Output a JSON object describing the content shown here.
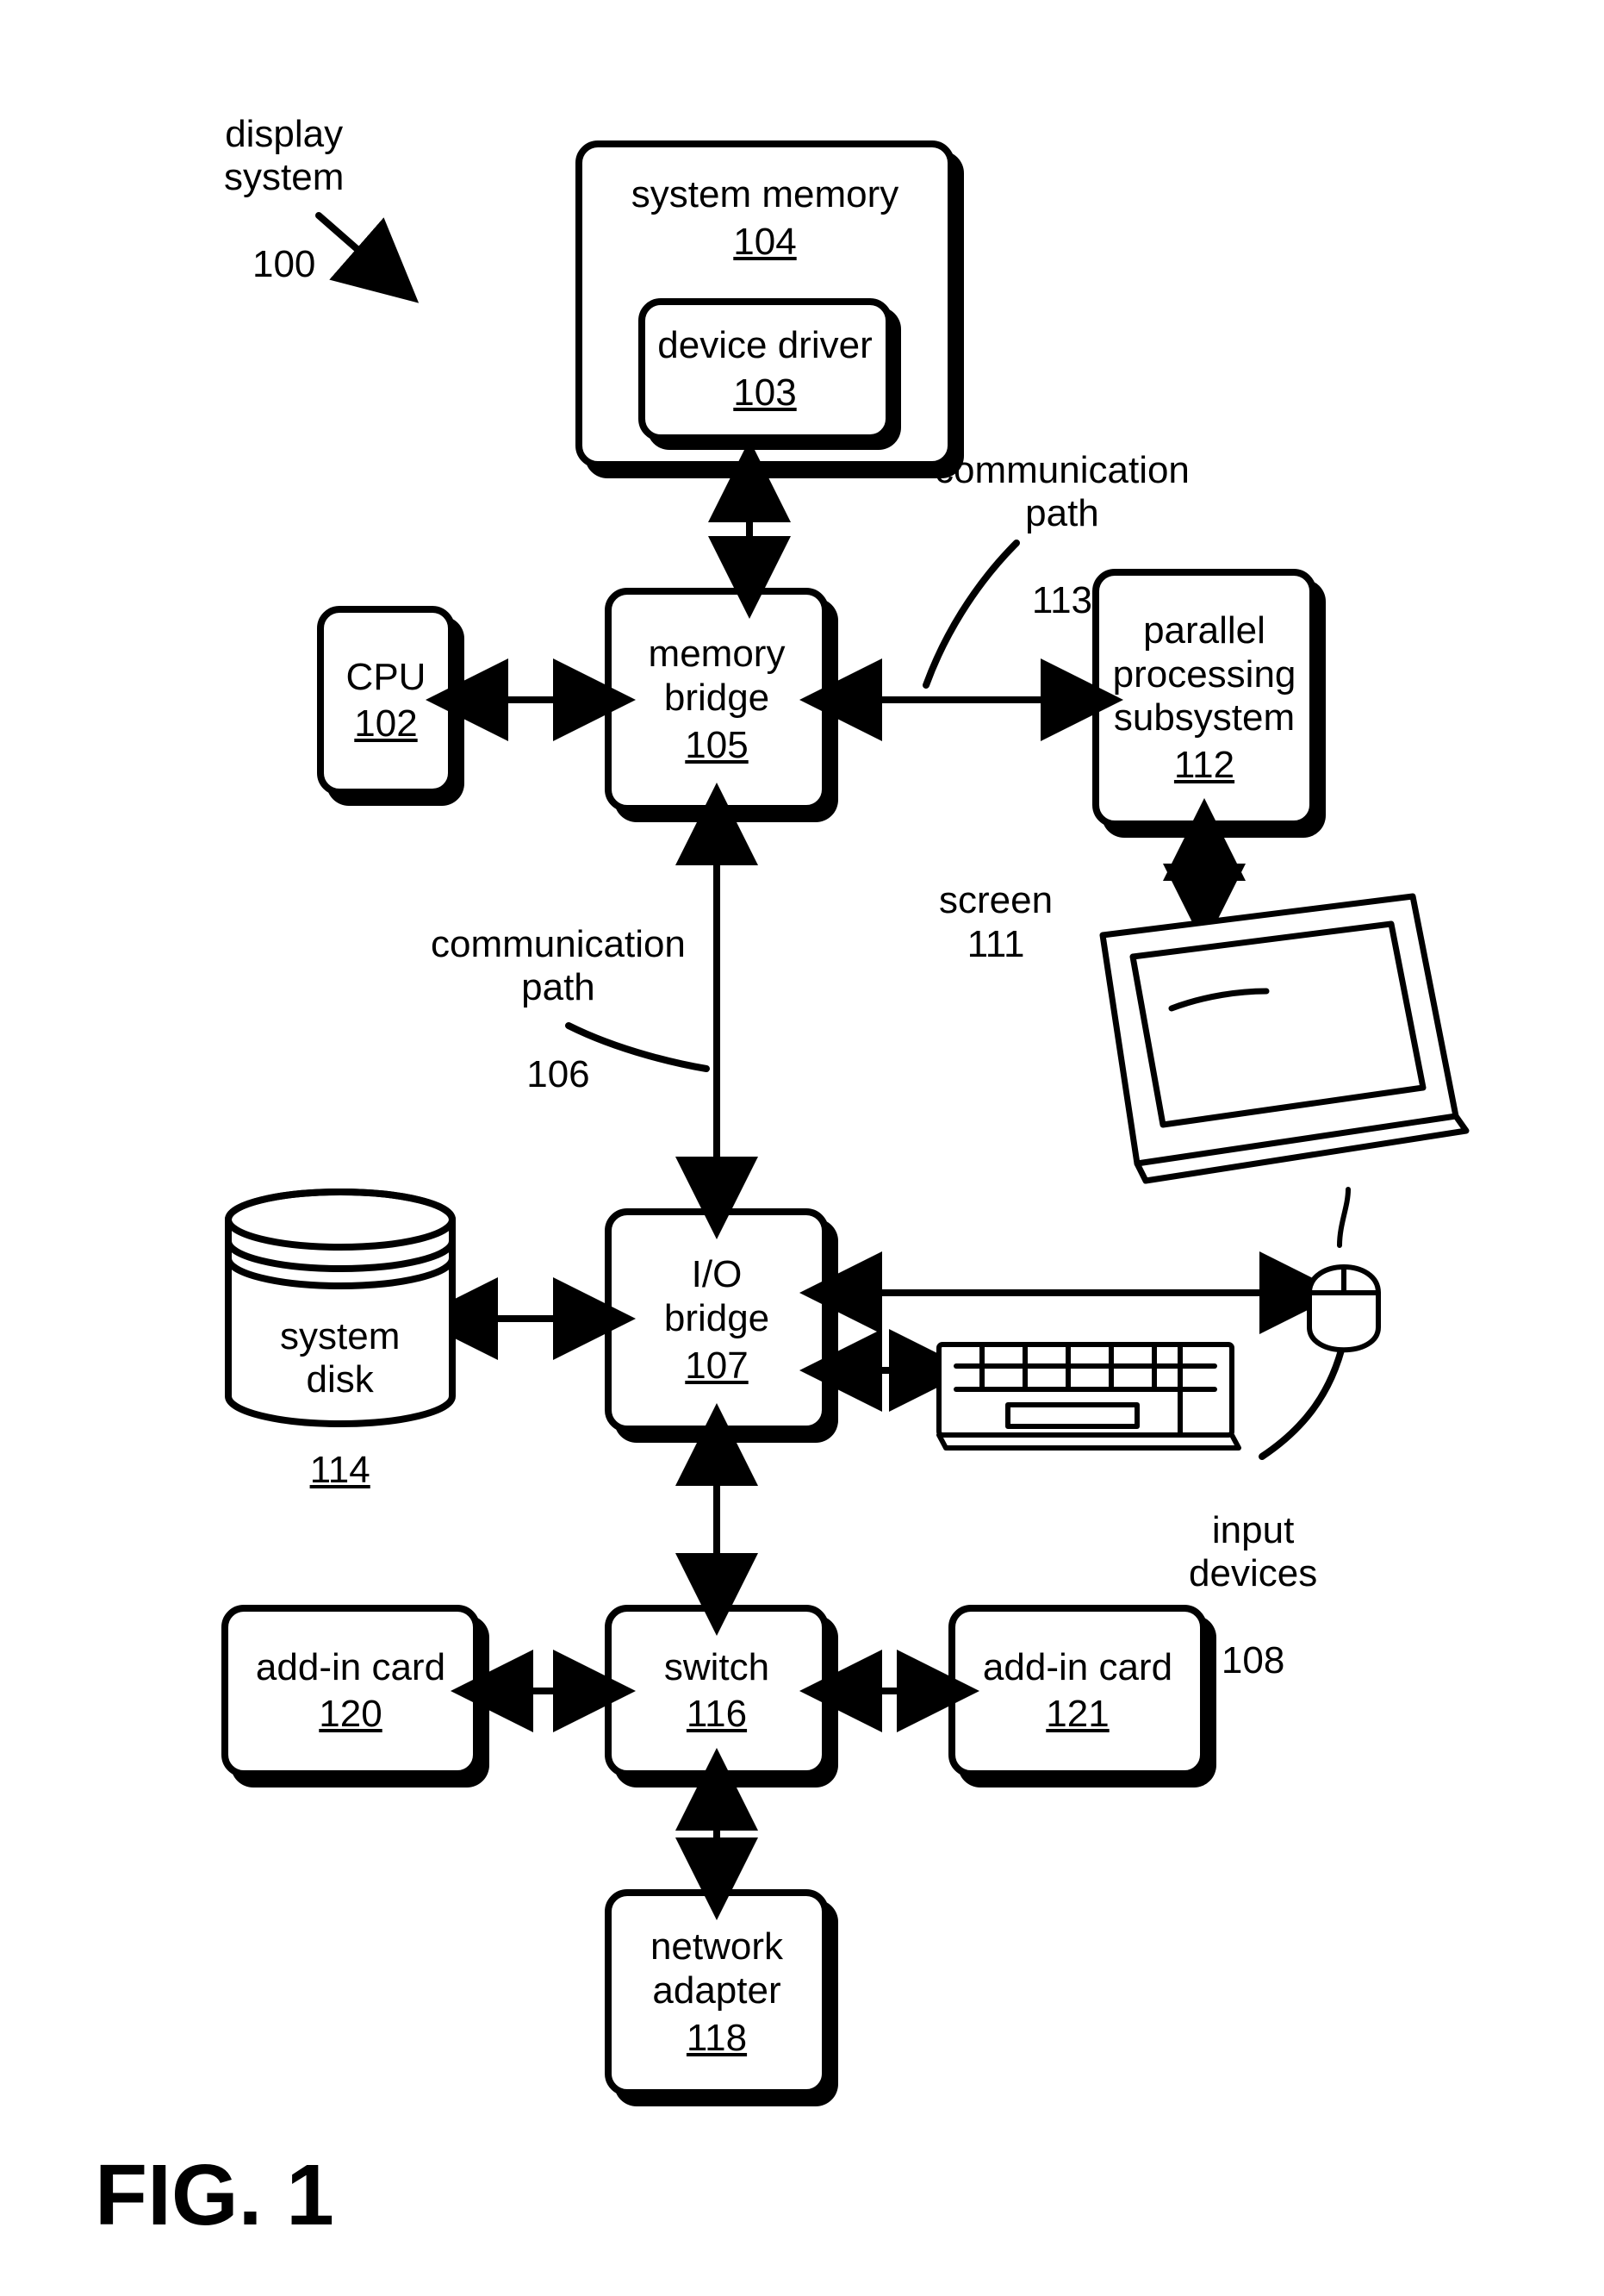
{
  "figure_label": "FIG. 1",
  "pointer": {
    "label": "display\nsystem",
    "num": "100"
  },
  "comm_path_a": {
    "label": "communication\npath",
    "num": "113"
  },
  "comm_path_b": {
    "label": "communication\npath",
    "num": "106"
  },
  "screen_label": {
    "label": "screen",
    "num": "111"
  },
  "input_devices": {
    "label": "input\ndevices",
    "num": "108"
  },
  "boxes": {
    "system_memory": {
      "label": "system memory",
      "num": "104"
    },
    "device_driver": {
      "label": "device driver",
      "num": "103"
    },
    "cpu": {
      "label": "CPU",
      "num": "102"
    },
    "memory_bridge": {
      "label": "memory\nbridge",
      "num": "105"
    },
    "pps": {
      "label": "parallel\nprocessing\nsubsystem",
      "num": "112"
    },
    "system_disk": {
      "label": "system\ndisk",
      "num": "114"
    },
    "io_bridge": {
      "label": "I/O\nbridge",
      "num": "107"
    },
    "addin_120": {
      "label": "add-in card",
      "num": "120"
    },
    "switch": {
      "label": "switch",
      "num": "116"
    },
    "addin_121": {
      "label": "add-in card",
      "num": "121"
    },
    "net_adapter": {
      "label": "network\nadapter",
      "num": "118"
    }
  }
}
